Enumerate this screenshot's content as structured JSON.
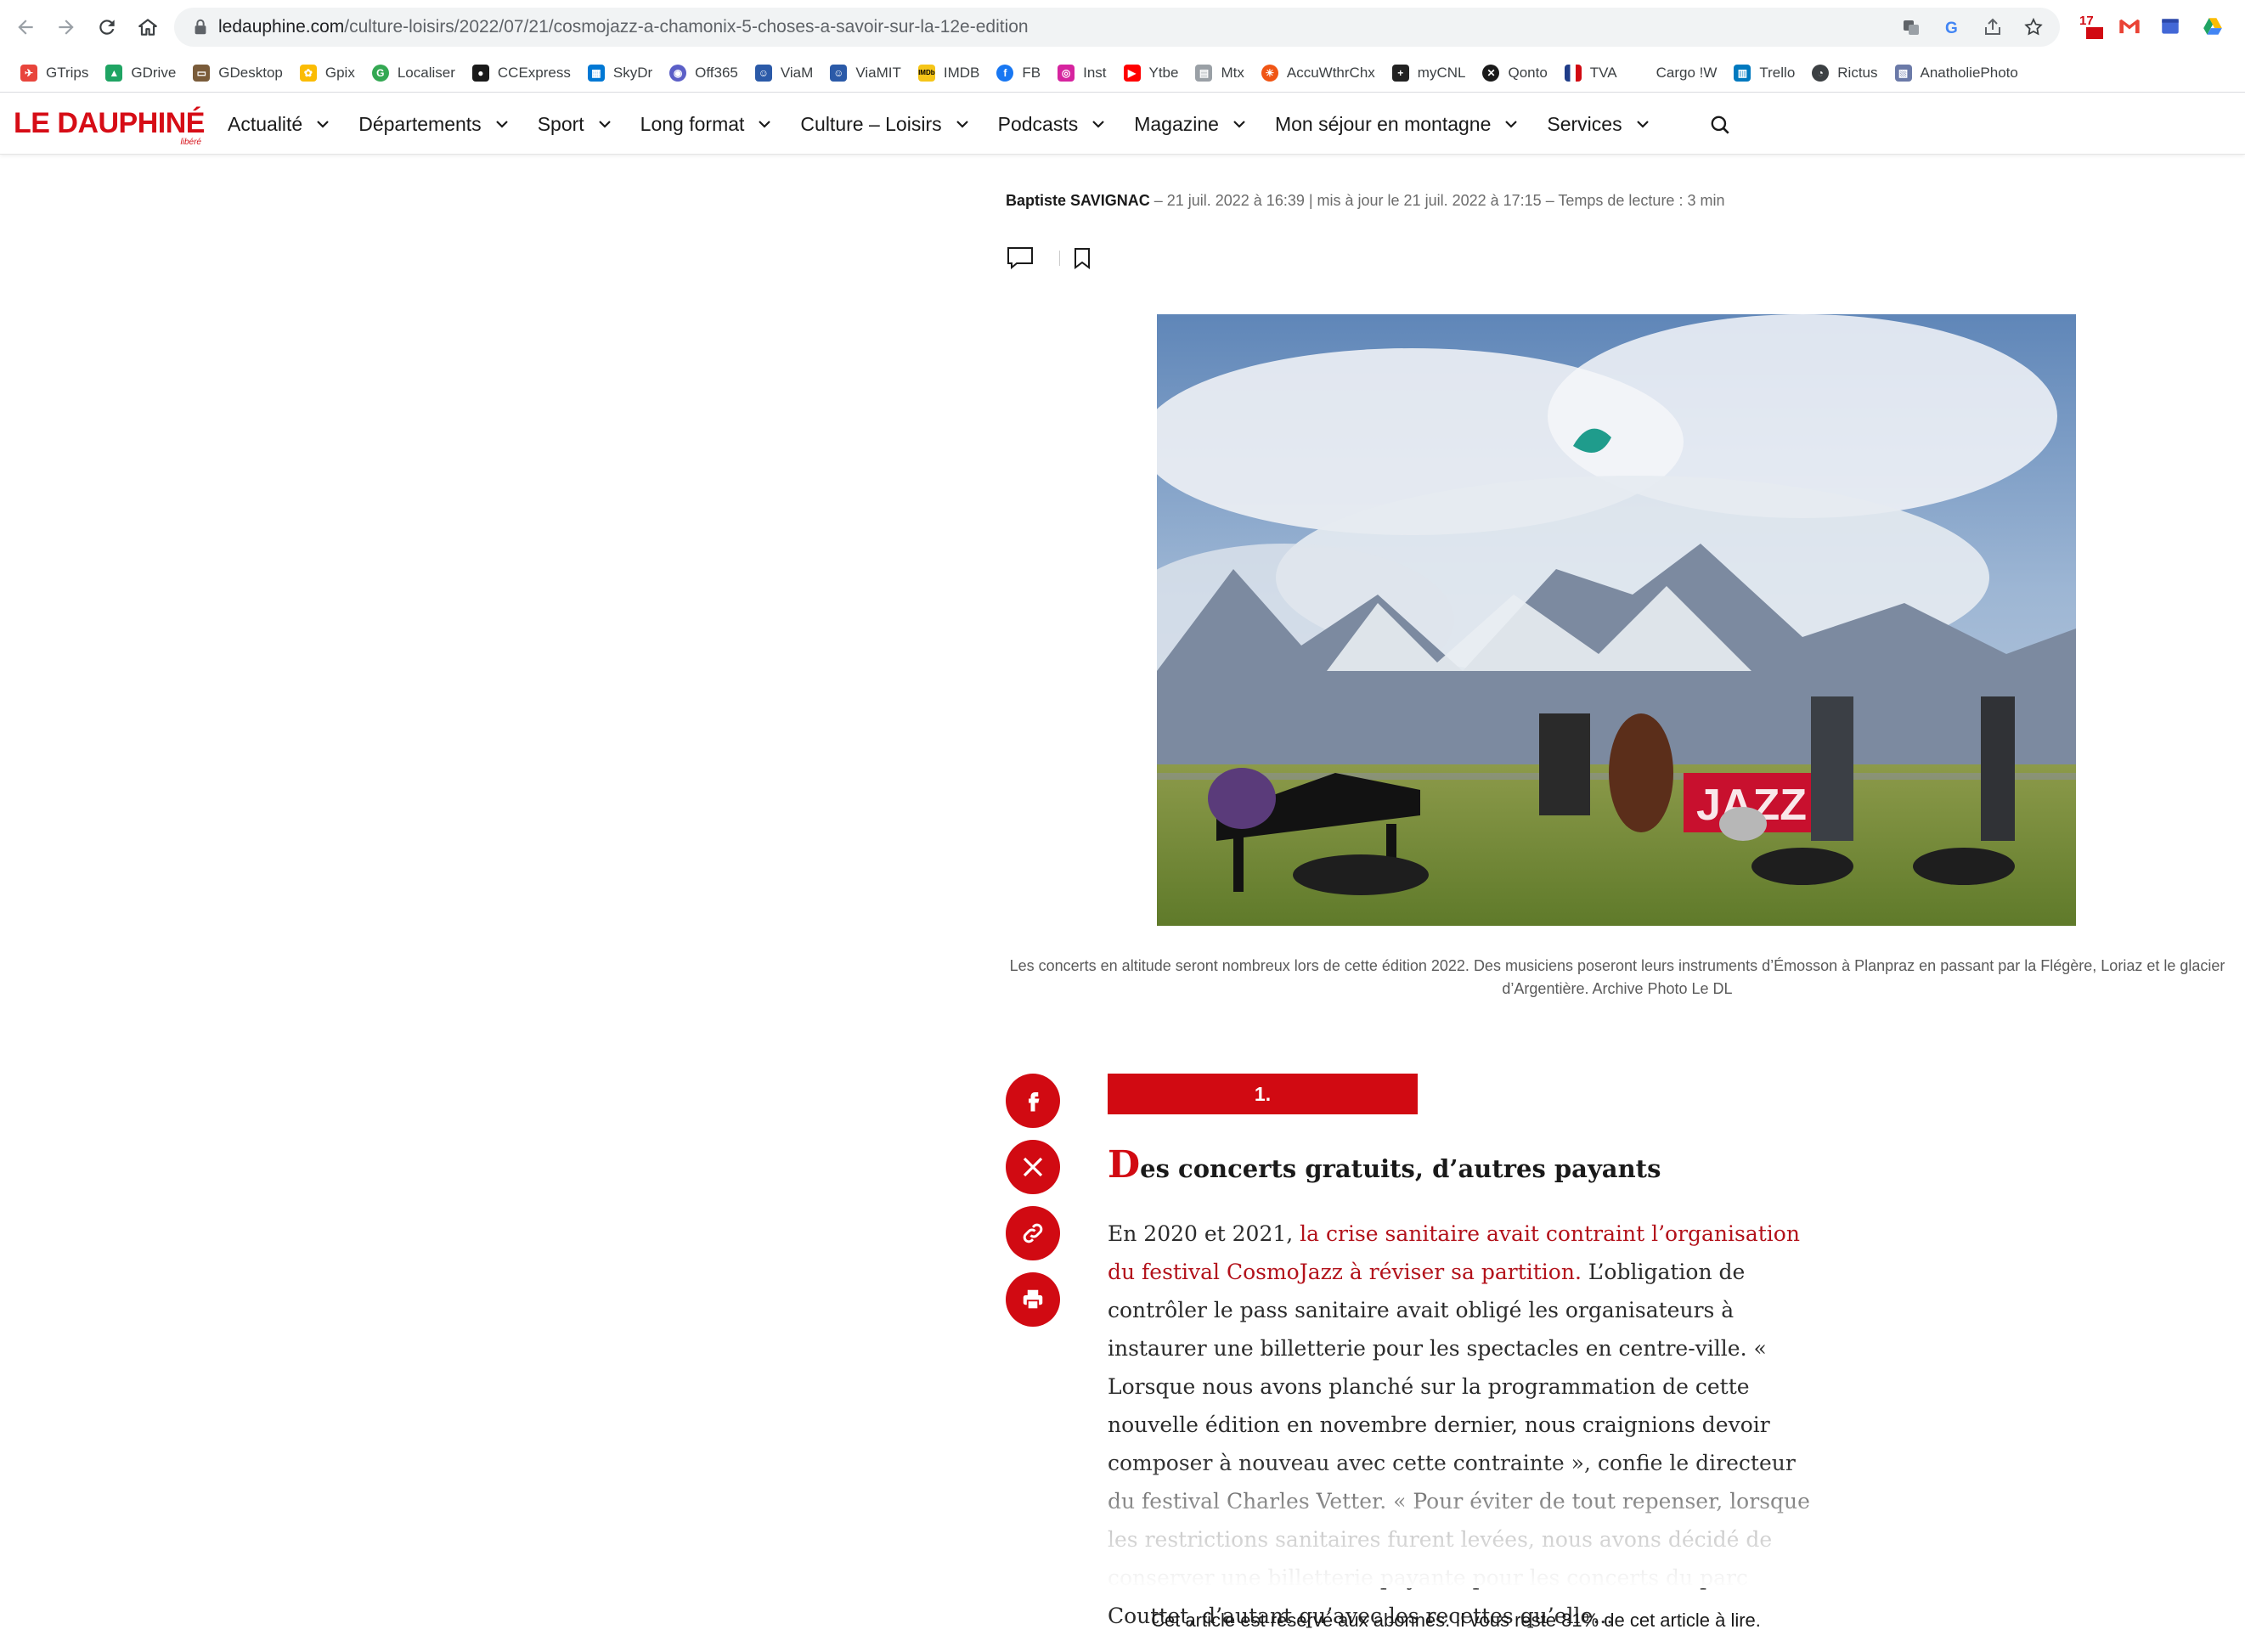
{
  "browser": {
    "url_domain": "ledauphine.com",
    "url_path": "/culture-loisirs/2022/07/21/cosmojazz-a-chamonix-5-choses-a-savoir-sur-la-12e-edition",
    "calendar_badge": "17"
  },
  "bookmarks": [
    {
      "label": "GTrips",
      "color": "#e8453c"
    },
    {
      "label": "GDrive",
      "color": "#1fa463"
    },
    {
      "label": "GDesktop",
      "color": "#7a5c3a"
    },
    {
      "label": "Gpix",
      "color": "#fbbc04"
    },
    {
      "label": "Localiser",
      "color": "#34a853"
    },
    {
      "label": "CCExpress",
      "color": "#1a1a1a"
    },
    {
      "label": "SkyDr",
      "color": "#0078d4"
    },
    {
      "label": "Off365",
      "color": "#5b5fc7"
    },
    {
      "label": "ViaM",
      "color": "#2b5aa8"
    },
    {
      "label": "ViaMIT",
      "color": "#2b5aa8"
    },
    {
      "label": "IMDB",
      "color": "#f5c518"
    },
    {
      "label": "FB",
      "color": "#1877f2"
    },
    {
      "label": "Inst",
      "color": "#d6249f"
    },
    {
      "label": "Ytbe",
      "color": "#ff0000"
    },
    {
      "label": "Mtx",
      "color": "#9aa0a6"
    },
    {
      "label": "AccuWthrChx",
      "color": "#f05514"
    },
    {
      "label": "myCNL",
      "color": "#222222"
    },
    {
      "label": "Qonto",
      "color": "#1a1a1a"
    },
    {
      "label": "TVA",
      "color": "#1f3c88"
    },
    {
      "label": "Cargo !W",
      "color": "#ffffff"
    },
    {
      "label": "Trello",
      "color": "#0079bf"
    },
    {
      "label": "Rictus",
      "color": "#3c4043"
    },
    {
      "label": "AnatholiePhoto",
      "color": "#6b7aa8"
    }
  ],
  "site": {
    "logo_text": "LE DAUPHINÉ",
    "logo_sub": "libéré",
    "menu": [
      "Actualité",
      "Départements",
      "Sport",
      "Long format",
      "Culture – Loisirs",
      "Podcasts",
      "Magazine",
      "Mon séjour en montagne",
      "Services"
    ]
  },
  "article": {
    "author": "Baptiste SAVIGNAC",
    "meta": " – 21 juil. 2022 à 16:39 | mis à jour le 21 juil. 2022 à 17:15 – Temps de lecture : 3 min",
    "photo_caption": "Les concerts en altitude seront nombreux lors de cette édition 2022. Des musiciens poseront leurs instruments d’Émosson à Planpraz en passant par la Flégère, Loriaz et le glacier d’Argentière. Archive Photo Le DL",
    "photo_banner": "JAZZ",
    "section_number": "1.",
    "section_drop": "D",
    "section_title_rest": "es concerts gratuits, d’autres payants",
    "para_lead": "En 2020 et 2021, ",
    "para_link": "la crise sanitaire avait contraint l’organisation du festival CosmoJazz à réviser sa partition.",
    "para_rest": " L’obligation de contrôler le pass sanitaire avait obligé les organisateurs à instaurer une billetterie pour les spectacles en centre-ville. « Lorsque nous avons planché sur la programmation de cette nouvelle édition en novembre dernier, nous craignions devoir composer à nouveau avec cette contrainte », confie le directeur du festival Charles Vetter. « Pour éviter de tout repenser, lorsque les restrictions sanitaires furent levées, nous avons décidé de conserver une billetterie payante pour les concerts du parc Couttet, d’autant qu’avec les recettes qu’elle...",
    "paywall": "Cet article est réservé aux abonnés. Il vous reste 81% de cet article à lire."
  },
  "colors": {
    "brand_red": "#d10a12",
    "link_red": "#b3121b"
  }
}
